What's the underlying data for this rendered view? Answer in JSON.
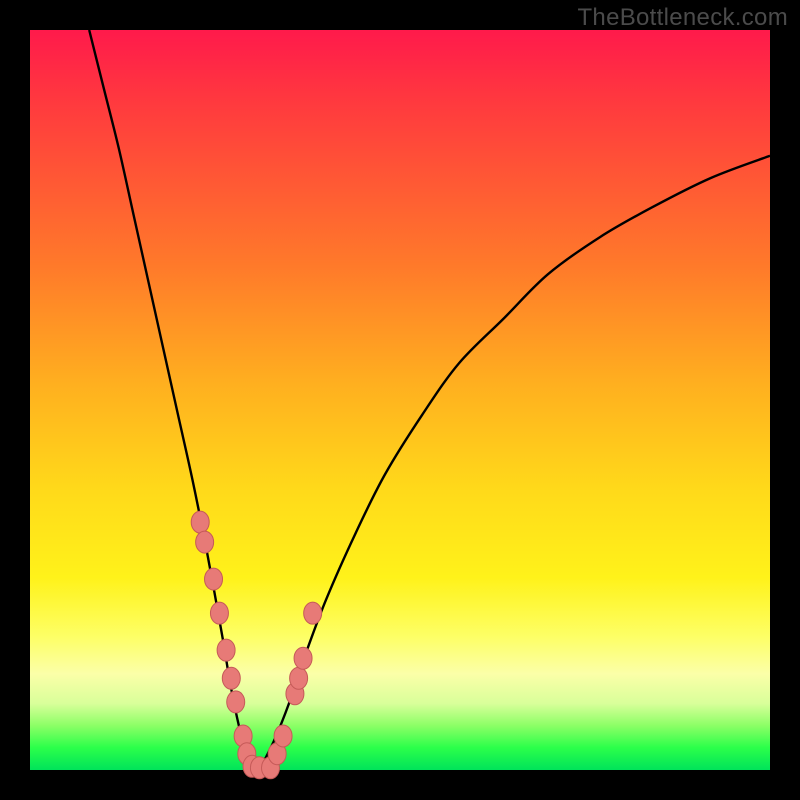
{
  "watermark": "TheBottleneck.com",
  "colors": {
    "frame": "#000000",
    "curve": "#000000",
    "point_fill": "#e77a77",
    "point_stroke": "#c55a58"
  },
  "chart_data": {
    "type": "line",
    "title": "",
    "xlabel": "",
    "ylabel": "",
    "xlim": [
      0,
      100
    ],
    "ylim": [
      0,
      100
    ],
    "note": "Axis values are estimated from pixel positions; chart has no visible tick labels.",
    "curve_left": {
      "x": [
        8,
        10,
        12,
        14,
        16,
        18,
        20,
        22,
        24,
        26,
        27,
        28,
        29,
        30,
        31
      ],
      "y": [
        100,
        92,
        84,
        75,
        66,
        57,
        48,
        39,
        29,
        18,
        12,
        7,
        3,
        1,
        0
      ]
    },
    "curve_right": {
      "x": [
        31,
        33,
        35,
        37,
        40,
        44,
        48,
        53,
        58,
        64,
        70,
        77,
        84,
        92,
        100
      ],
      "y": [
        0,
        4,
        9,
        15,
        23,
        32,
        40,
        48,
        55,
        61,
        67,
        72,
        76,
        80,
        83
      ]
    },
    "flat_segment": {
      "x": [
        29,
        33
      ],
      "y": [
        0,
        0
      ]
    },
    "series": [
      {
        "name": "points",
        "x": [
          23.0,
          23.6,
          24.8,
          25.6,
          26.5,
          27.2,
          27.8,
          28.8,
          29.3,
          30.0,
          31.0,
          32.5,
          33.4,
          34.2,
          35.8,
          36.3,
          36.9,
          38.2
        ],
        "y": [
          33.5,
          30.8,
          25.8,
          21.2,
          16.2,
          12.4,
          9.2,
          4.6,
          2.2,
          0.5,
          0.3,
          0.3,
          2.2,
          4.6,
          10.3,
          12.4,
          15.1,
          21.2
        ]
      }
    ]
  }
}
